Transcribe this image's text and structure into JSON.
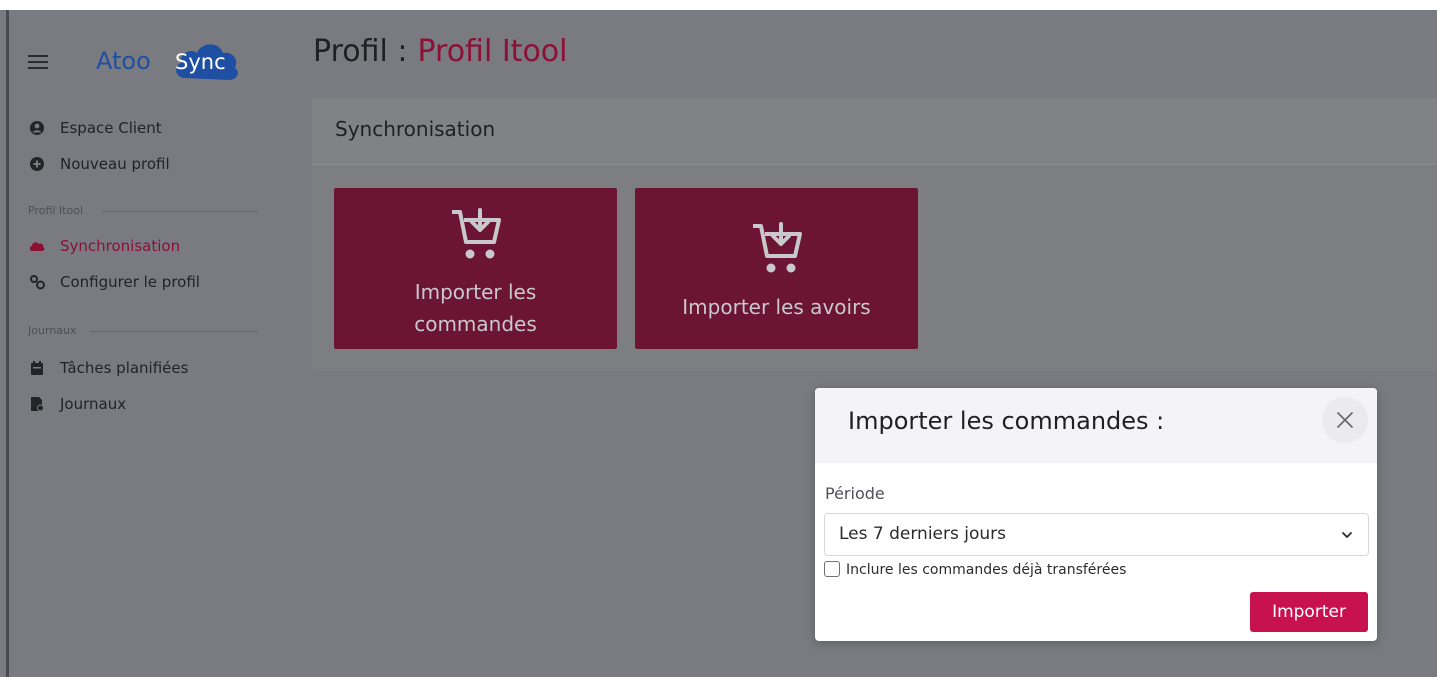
{
  "header": {
    "logo_text": "Atoo",
    "logo_badge": "Sync",
    "title_prefix": "Profil :",
    "title_profile": "Profil Itool"
  },
  "sidebar": {
    "items": [
      {
        "label": "Espace Client",
        "icon": "user-circle-icon"
      },
      {
        "label": "Nouveau profil",
        "icon": "plus-circle-icon"
      }
    ],
    "section_profile": "Profil Itool",
    "profile_items": [
      {
        "label": "Synchronisation",
        "icon": "cloud-sync-icon",
        "active": true
      },
      {
        "label": "Configurer le profil",
        "icon": "gears-icon"
      }
    ],
    "section_journaux": "Journaux",
    "journal_items": [
      {
        "label": "Tâches planifiées",
        "icon": "calendar-icon"
      },
      {
        "label": "Journaux",
        "icon": "log-file-icon"
      }
    ]
  },
  "main": {
    "panel_title": "Synchronisation",
    "tiles": [
      {
        "line1": "Importer les",
        "line2": "commandes",
        "icon": "cart-download-icon"
      },
      {
        "line1": "Importer les avoirs",
        "icon": "cart-download-icon"
      }
    ]
  },
  "modal": {
    "title": "Importer les commandes :",
    "period_label": "Période",
    "period_value": "Les 7 derniers jours",
    "include_label": "Inclure les commandes déjà transférées",
    "include_checked": false,
    "submit_label": "Importer"
  },
  "colors": {
    "accent": "#8c0f36",
    "tile_bg": "#6b1533",
    "button": "#c8124f",
    "logo_blue": "#1f4fa3"
  }
}
